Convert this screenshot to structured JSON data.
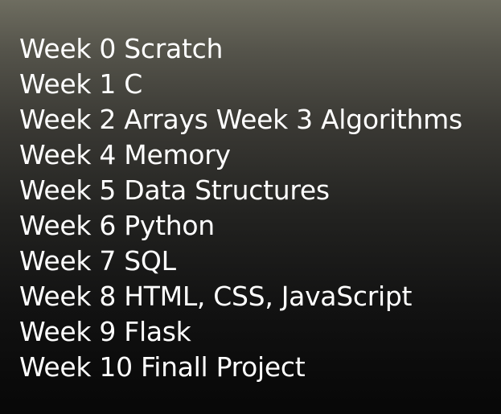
{
  "lines": [
    "Week 0 Scratch",
    "Week 1 C",
    "Week 2 Arrays Week 3 Algorithms",
    "Week 4 Memory",
    "Week 5 Data Structures",
    "Week 6 Python",
    "Week 7 SQL",
    "Week 8 HTML, CSS, JavaScript",
    "Week 9 Flask",
    "Week 10 Finall Project"
  ]
}
